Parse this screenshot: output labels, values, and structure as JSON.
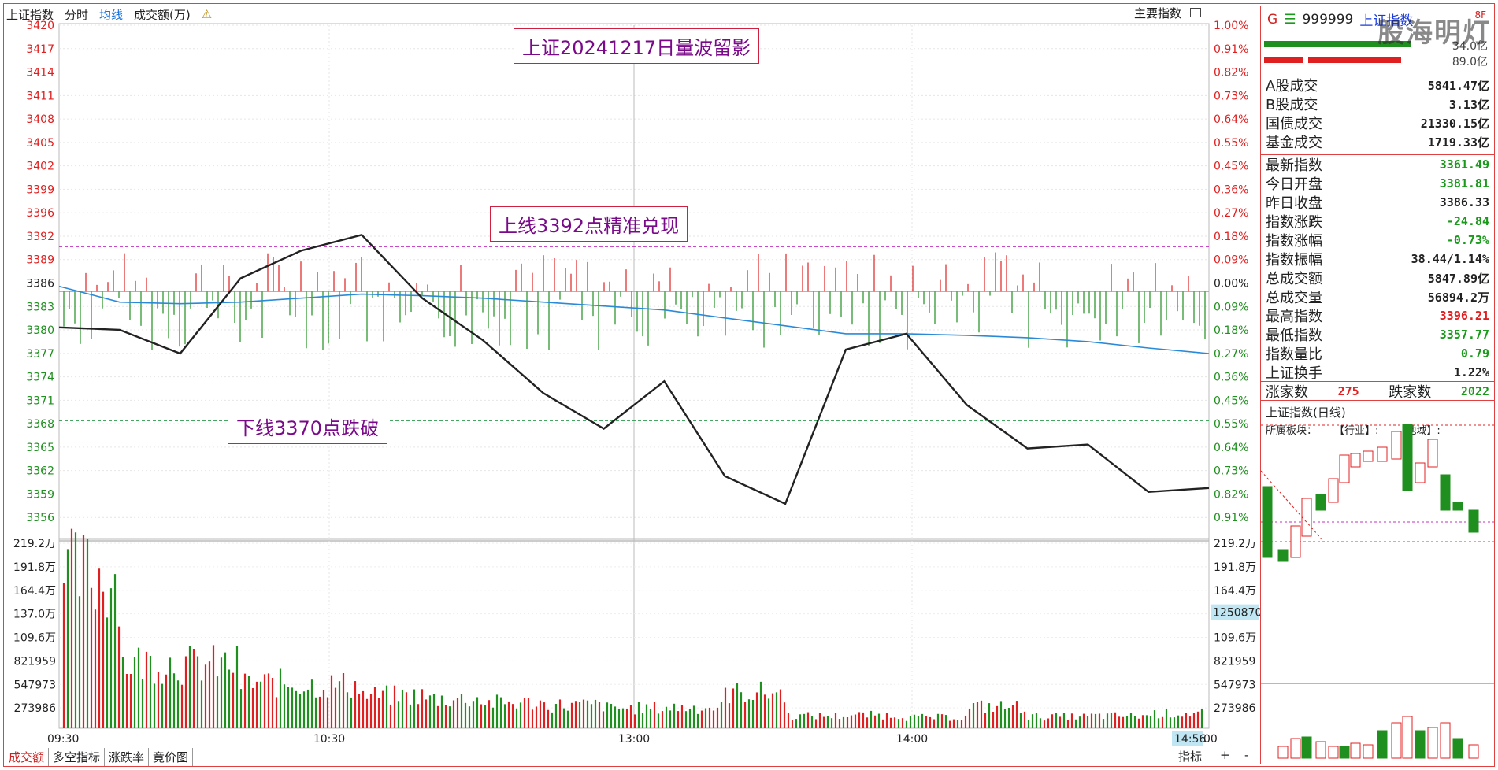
{
  "toolbar": {
    "index_name": "上证指数",
    "tab_timeshare": "分时",
    "tab_avgline": "均线",
    "tab_volume": "成交额(万)",
    "main_index_label": "主要指数"
  },
  "price_axis": {
    "ticks": [
      "3420",
      "3417",
      "3414",
      "3411",
      "3408",
      "3405",
      "3402",
      "3399",
      "3396",
      "3392",
      "3389",
      "3386",
      "3383",
      "3380",
      "3377",
      "3374",
      "3371",
      "3368",
      "3365",
      "3362",
      "3359",
      "3356"
    ],
    "ref_price": 3386.33
  },
  "pct_axis": {
    "ticks": [
      "1.00%",
      "0.91%",
      "0.82%",
      "0.73%",
      "0.64%",
      "0.55%",
      "0.45%",
      "0.36%",
      "0.27%",
      "0.18%",
      "0.09%",
      "0.00%",
      "0.09%",
      "0.18%",
      "0.27%",
      "0.36%",
      "0.45%",
      "0.55%",
      "0.64%",
      "0.73%",
      "0.82%",
      "0.91%"
    ]
  },
  "volume_axis": {
    "left_ticks": [
      "219.2万",
      "191.8万",
      "164.4万",
      "137.0万",
      "109.6万",
      "821959",
      "547973",
      "273986"
    ],
    "right_ticks": [
      "219.2万",
      "191.8万",
      "164.4万",
      "",
      "109.6万",
      "821959",
      "547973",
      "273986"
    ],
    "current_value": "1250870"
  },
  "time_axis": {
    "labels": [
      "09:30",
      "10:30",
      "13:00",
      "14:00"
    ],
    "cursor_time": "14:56",
    "end_fragment": "00"
  },
  "annotations": {
    "title": "上证20241217日量波留影",
    "upper": "上线3392点精准兑现",
    "lower": "下线3370点跌破"
  },
  "bottom_tabs": [
    "成交额",
    "多空指标",
    "涨跌率",
    "竟价图"
  ],
  "bottom_right": {
    "indicator": "指标",
    "plus": "+",
    "minus": "-"
  },
  "right_panel": {
    "prefix": "G",
    "menu_glyph": "☰",
    "code": "999999",
    "name": "上证指数",
    "top_small": "8F",
    "bar_values": [
      "34.0亿",
      "89.0亿"
    ],
    "stats_a": [
      {
        "label": "A股成交",
        "value": "5841.47亿"
      },
      {
        "label": "B股成交",
        "value": "3.13亿"
      },
      {
        "label": "国债成交",
        "value": "21330.15亿"
      },
      {
        "label": "基金成交",
        "value": "1719.33亿"
      }
    ],
    "stats_b": [
      {
        "label": "最新指数",
        "value": "3361.49",
        "color": "green"
      },
      {
        "label": "今日开盘",
        "value": "3381.81",
        "color": "green"
      },
      {
        "label": "昨日收盘",
        "value": "3386.33",
        "color": "black"
      },
      {
        "label": "指数涨跌",
        "value": "-24.84",
        "color": "green"
      },
      {
        "label": "指数涨幅",
        "value": "-0.73%",
        "color": "green"
      },
      {
        "label": "指数振幅",
        "value": "38.44/1.14%",
        "color": "black"
      },
      {
        "label": "总成交额",
        "value": "5847.89亿",
        "color": "black"
      },
      {
        "label": "总成交量",
        "value": "56894.2万",
        "color": "black"
      },
      {
        "label": "最高指数",
        "value": "3396.21",
        "color": "red"
      },
      {
        "label": "最低指数",
        "value": "3357.77",
        "color": "green"
      },
      {
        "label": "指数量比",
        "value": "0.79",
        "color": "green"
      },
      {
        "label": "上证换手",
        "value": "1.22%",
        "color": "black"
      }
    ],
    "up_label": "涨家数",
    "up_count": "275",
    "down_label": "跌家数",
    "down_count": "2022",
    "daily_title": "上证指数(日线)",
    "sector_label": "所属板块：",
    "industry_label": "【行业】:",
    "region_label": "【地域】:",
    "watermark": "股海明灯"
  },
  "colors": {
    "up": "#e02020",
    "down": "#1f8f1f",
    "price_line": "#222222",
    "avg_line": "#2a8ad8",
    "upper_line": "#c030c0",
    "lower_line": "#2a9a4a"
  },
  "chart_data": {
    "type": "line",
    "title": "",
    "xlabel": "",
    "ylabel": "",
    "x": [
      "09:30",
      "09:40",
      "09:50",
      "10:00",
      "10:10",
      "10:20",
      "10:30",
      "10:45",
      "11:00",
      "11:15",
      "11:30",
      "13:00",
      "13:15",
      "13:30",
      "13:45",
      "14:00",
      "14:15",
      "14:30",
      "14:45",
      "14:56"
    ],
    "ylim": [
      3356,
      3420
    ],
    "series": [
      {
        "name": "",
        "values": [
          3381.8,
          3381.5,
          3378.5,
          3388.0,
          3391.5,
          3393.5,
          3385.5,
          3380.2,
          3373.5,
          3369.0,
          3375.0,
          3363.0,
          3359.5,
          3379.0,
          3381.0,
          3372.0,
          3366.5,
          3367.0,
          3361.0,
          3361.5
        ]
      },
      {
        "name": "",
        "values": [
          3387.0,
          3385.0,
          3384.8,
          3385.0,
          3385.5,
          3386.0,
          3385.8,
          3385.5,
          3385.0,
          3384.5,
          3384.0,
          3383.0,
          3382.0,
          3381.0,
          3381.0,
          3380.8,
          3380.5,
          3380.0,
          3379.2,
          3378.5
        ]
      }
    ],
    "reference_lines": [
      3392,
      3370
    ],
    "volume": [
      1970000,
      850000,
      820000,
      580000,
      560000,
      420000,
      380000,
      330000,
      300000,
      260000,
      270000,
      460000,
      160000,
      170000,
      140000,
      280000,
      150000,
      160000,
      190000,
      300000
    ]
  }
}
